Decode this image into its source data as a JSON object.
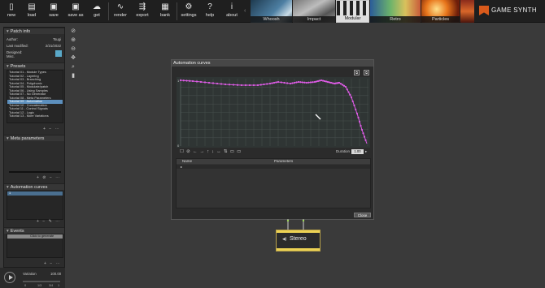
{
  "toolbar": {
    "buttons": [
      {
        "label": "new",
        "icon": "new-doc-icon"
      },
      {
        "label": "load",
        "icon": "load-icon"
      },
      {
        "label": "save",
        "icon": "save-icon"
      },
      {
        "label": "save as",
        "icon": "save-as-icon"
      },
      {
        "label": "get",
        "icon": "cloud-icon"
      },
      {
        "label": "render",
        "icon": "render-icon"
      },
      {
        "label": "export",
        "icon": "export-icon"
      },
      {
        "label": "bank",
        "icon": "bank-icon"
      },
      {
        "label": "settings",
        "icon": "gear-icon"
      },
      {
        "label": "help",
        "icon": "help-icon"
      },
      {
        "label": "about",
        "icon": "info-icon"
      }
    ],
    "modules": [
      "Whoosh",
      "Impact",
      "Modular",
      "Retro",
      "Particles"
    ],
    "logo": "GAME SYNTH"
  },
  "patch_info": {
    "title": "Patch info",
    "author_label": "Author:",
    "author_value": "Tsugi",
    "modified_label": "Last modified:",
    "modified_value": "2/21/2022",
    "designed_label": "Designed:",
    "designed_value": "Misc."
  },
  "presets": {
    "title": "Presets",
    "items": [
      "Tutorial 01 - Module Types",
      "Tutorial 02 - Layering",
      "Tutorial 03 - Branching",
      "Tutorial 04 - Polyphonic",
      "Tutorial 05 - Modulate/patch",
      "Tutorial 06 - Using Samples",
      "Tutorial 07 - No Generator",
      "Tutorial 08 - Meta Parameters",
      "Tutorial 09 - Automation",
      "Tutorial 10 - Concatenation",
      "Tutorial 11 - Control Signals",
      "Tutorial 12 - Logic",
      "Tutorial 13 - More Variations"
    ],
    "selected_index": 8
  },
  "meta_parameters": {
    "title": "Meta parameters"
  },
  "automation_curves": {
    "title": "Automation curves",
    "items": [
      "1"
    ]
  },
  "events": {
    "title": "Events",
    "items": [
      "Click to generate"
    ]
  },
  "player": {
    "variation_label": "Variation",
    "variation_value": "100.00",
    "ticks": [
      "0",
      "1/3",
      "3/4",
      "1"
    ]
  },
  "window": {
    "title": "Automation curves",
    "duration_label": "Duration",
    "duration_value": "1.00",
    "columns": [
      "Name",
      "Parameters"
    ],
    "close_label": "Close",
    "plot": {
      "y_max_label": "1",
      "y_min_label": "0"
    }
  },
  "node": {
    "label": "Stereo"
  },
  "colors": {
    "accent": "#5c8fbd",
    "curve": "#e05ce8",
    "node": "#ecd254",
    "logo": "#d95a1b"
  }
}
